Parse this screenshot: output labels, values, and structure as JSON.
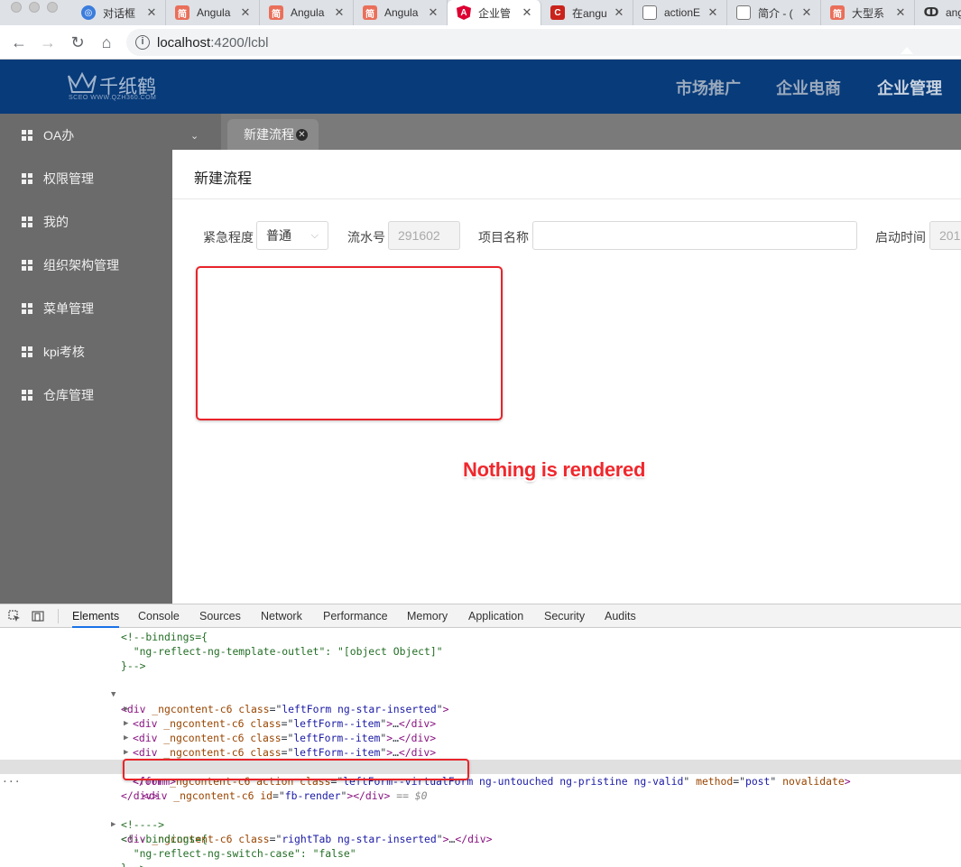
{
  "browser": {
    "tabs": [
      {
        "title": "对话框",
        "favicon": "dialog",
        "color": "#3b7ddd"
      },
      {
        "title": "Angula",
        "favicon": "jianshu",
        "color": "#ea6f5a"
      },
      {
        "title": "Angula",
        "favicon": "jianshu",
        "color": "#ea6f5a"
      },
      {
        "title": "Angula",
        "favicon": "jianshu",
        "color": "#ea6f5a"
      },
      {
        "title": "企业管",
        "favicon": "angular",
        "color": "#dd0031"
      },
      {
        "title": "在angu",
        "favicon": "csdn",
        "color": "#c9231b"
      },
      {
        "title": "actionE",
        "favicon": "doc",
        "color": "#777777"
      },
      {
        "title": "简介 - (",
        "favicon": "doc",
        "color": "#777777"
      },
      {
        "title": "大型系",
        "favicon": "jianshu",
        "color": "#ea6f5a"
      },
      {
        "title": "ang",
        "favicon": "github",
        "color": "#333333"
      }
    ],
    "active_tab": 4,
    "url_host": "localhost",
    "url_rest": ":4200/lcbl"
  },
  "header": {
    "logo_name": "千纸鹤",
    "logo_sub": "SCEO  WWW.QZH360.COM",
    "nav": [
      "市场推广",
      "企业电商",
      "企业管理"
    ],
    "active_nav": 2
  },
  "sidebar": {
    "items": [
      {
        "label": "OA办",
        "has_chevron": true
      },
      {
        "label": "权限管理"
      },
      {
        "label": "我的"
      },
      {
        "label": "组织架构管理"
      },
      {
        "label": "菜单管理"
      },
      {
        "label": "kpi考核"
      },
      {
        "label": "仓库管理"
      }
    ]
  },
  "page_tab": {
    "label": "新建流程",
    "close": "✕"
  },
  "modal": {
    "title": "新建流程",
    "fields": {
      "urgency_label": "紧急程度",
      "urgency_value": "普通",
      "serial_label": "流水号",
      "serial_value": "291602",
      "project_label": "项目名称",
      "project_value": "",
      "start_label": "启动时间",
      "start_value": "201"
    }
  },
  "annotation": "Nothing is rendered",
  "devtools": {
    "tabs": [
      "Elements",
      "Console",
      "Sources",
      "Network",
      "Performance",
      "Memory",
      "Application",
      "Security",
      "Audits"
    ],
    "active_tab": 0,
    "code": {
      "l1": "<!--bindings={",
      "l2": "  \"ng-reflect-ng-template-outlet\": \"[object Object]\"",
      "l3": "}-->",
      "l4_tag": "div",
      "l4_attr": "_ngcontent-c6",
      "l4_class": "leftForm ng-star-inserted",
      "item_class": "leftForm--item",
      "form_class": "leftForm--virtualForm ng-untouched ng-pristine ng-valid",
      "form_method": "post",
      "sel_id": "fb-render",
      "sel_suffix": " == $0",
      "close_form": "</form>",
      "close_div": "</div>",
      "right_class": "rightTab ng-star-inserted",
      "cm_empty": "<!---->",
      "l14": "<!--bindings={",
      "l15": "  \"ng-reflect-ng-switch-case\": \"false\"",
      "l16": "}-->"
    }
  },
  "colors": {
    "header_bg": "#083b7a",
    "sidebar_bg": "#6b6b6b",
    "annotation_red": "#e8242a"
  }
}
